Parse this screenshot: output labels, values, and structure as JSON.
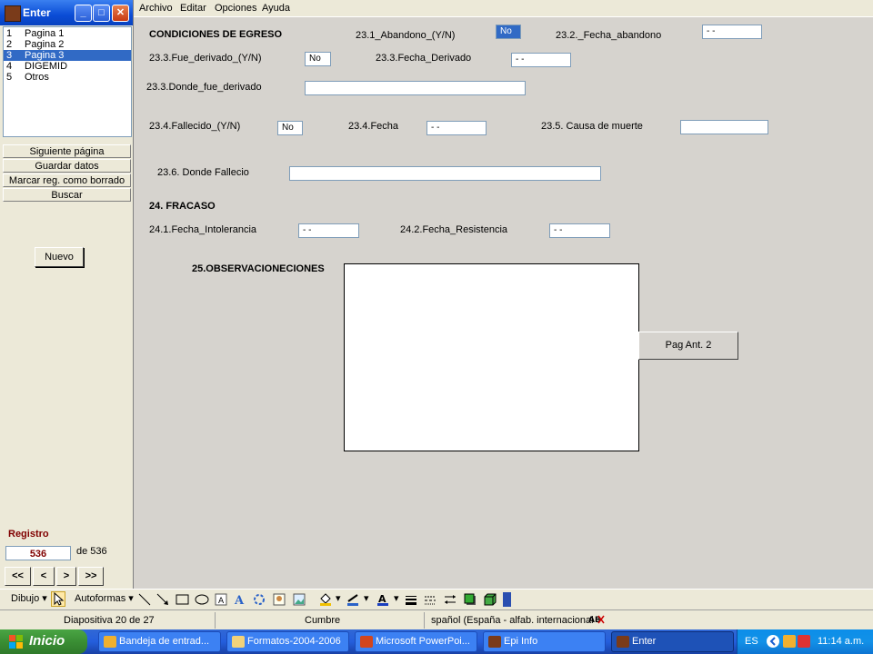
{
  "window": {
    "title": "Enter"
  },
  "page_list": [
    {
      "num": "1",
      "label": "Pagina 1"
    },
    {
      "num": "2",
      "label": "Pagina 2"
    },
    {
      "num": "3",
      "label": "Pagina 3"
    },
    {
      "num": "4",
      "label": "DIGEMID"
    },
    {
      "num": "5",
      "label": "Otros"
    }
  ],
  "left_buttons": {
    "next_page": "Siguiente página",
    "save": "Guardar datos",
    "mark_deleted": "Marcar reg. como borrado",
    "search": "Buscar",
    "new": "Nuevo"
  },
  "record": {
    "label": "Registro",
    "current": "536",
    "of_total": "de 536",
    "nav": [
      "<<",
      "<",
      ">",
      ">>"
    ]
  },
  "menu": [
    "Archivo",
    "Editar",
    "Opciones",
    "Ayuda"
  ],
  "form": {
    "section_egreso": "CONDICIONES DE EGRESO",
    "abandono_label": "23.1_Abandono_(Y/N)",
    "abandono_value": "No",
    "fecha_abandono_label": "23.2._Fecha_abandono",
    "fecha_abandono_value": " - -",
    "fue_derivado_label": "23.3.Fue_derivado_(Y/N)",
    "fue_derivado_value": "No",
    "fecha_derivado_label": "23.3.Fecha_Derivado",
    "fecha_derivado_value": " - -",
    "donde_derivado_label": "23.3.Donde_fue_derivado",
    "donde_derivado_value": "",
    "fallecido_label": "23.4.Fallecido_(Y/N)",
    "fallecido_value": "No",
    "fecha_label": "23.4.Fecha",
    "fecha_value": " - -",
    "causa_label": "23.5. Causa de muerte",
    "causa_value": "",
    "donde_fallecio_label": "23.6. Donde Fallecio",
    "donde_fallecio_value": "",
    "section_fracaso": "24. FRACASO",
    "fecha_intolerancia_label": "24.1.Fecha_Intolerancia",
    "fecha_intolerancia_value": " - -",
    "fecha_resistencia_label": "24.2.Fecha_Resistencia",
    "fecha_resistencia_value": " - -",
    "observaciones_label": "25.OBSERVACIONECIONES",
    "observaciones_value": "",
    "pag_ant_button": "Pag Ant. 2"
  },
  "draw_toolbar": {
    "dibujo": "Dibujo",
    "autoformas": "Autoformas"
  },
  "status_bar": {
    "slide": "Diapositiva 20 de 27",
    "design": "Cumbre",
    "language": "spañol (España - alfab. internacional"
  },
  "taskbar": {
    "start": "Inicio",
    "tasks": [
      {
        "label": "Bandeja de entrad...",
        "color": "#F0B030"
      },
      {
        "label": "Formatos-2004-2006",
        "color": "#F2D27A"
      },
      {
        "label": "Microsoft PowerPoi...",
        "color": "#D2461E"
      },
      {
        "label": "Epi Info",
        "color": "#7a3b1a"
      },
      {
        "label": "Enter",
        "color": "#7a3b1a"
      }
    ],
    "lang": "ES",
    "clock": "11:14 a.m."
  }
}
